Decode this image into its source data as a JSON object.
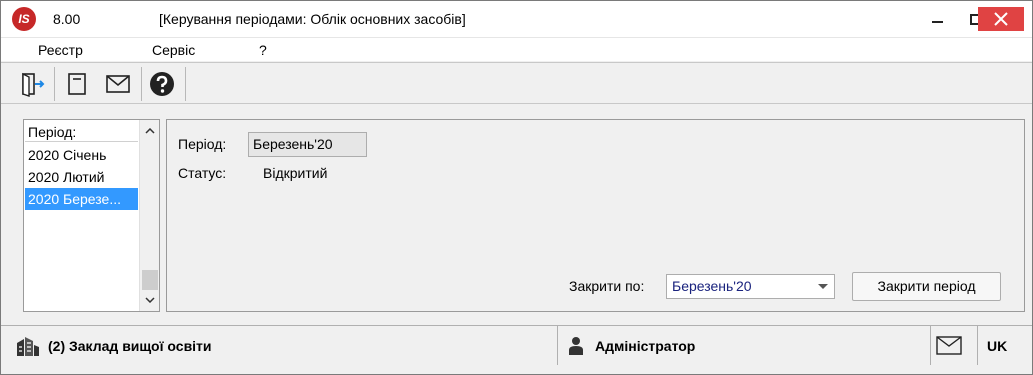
{
  "titlebar": {
    "logo": "IS",
    "version": "8.00",
    "title": "[Керування періодами: Облік основних засобів]"
  },
  "menu": {
    "items": [
      "Реєстр",
      "Сервіс",
      "?"
    ]
  },
  "toolbar": {
    "buttons": [
      "exit-icon",
      "document-icon",
      "mail-icon",
      "help-icon"
    ]
  },
  "period_list": {
    "header": "Період:",
    "items": [
      "2020 Січень",
      "2020 Лютий",
      "2020 Березе..."
    ],
    "selected_index": 2
  },
  "details": {
    "period_label": "Період:",
    "period_value": "Березень'20",
    "status_label": "Статус:",
    "status_value": "Відкритий",
    "close_by_label": "Закрити по:",
    "close_by_value": "Березень'20",
    "close_button": "Закрити період"
  },
  "statusbar": {
    "organization": "(2) Заклад вищої освіти",
    "user": "Адміністратор",
    "language": "UK"
  },
  "colors": {
    "selection": "#3399ff",
    "close_button": "#e04343",
    "logo": "#c62828"
  }
}
